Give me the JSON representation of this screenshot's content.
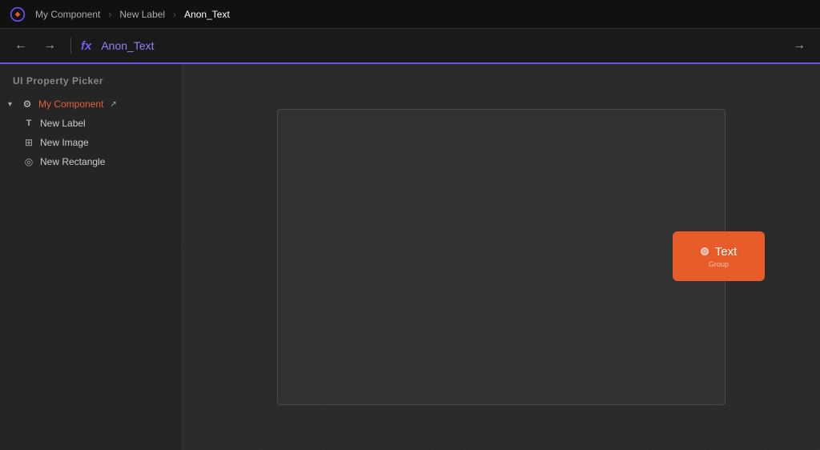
{
  "topbar": {
    "breadcrumbs": [
      {
        "label": "My Component",
        "active": false
      },
      {
        "label": "New Label",
        "active": false
      },
      {
        "label": "Anon_Text",
        "active": true
      }
    ]
  },
  "toolbar": {
    "back_label": "←",
    "forward_label": "→",
    "fx_label": "fx",
    "formula_value": "Anon_Text",
    "toolbar_back_label": "→"
  },
  "sidebar": {
    "title": "UI Property Picker",
    "tree": {
      "root": {
        "label": "My Component",
        "icon": "⚙",
        "children": [
          {
            "label": "New Label",
            "icon": "T"
          },
          {
            "label": "New Image",
            "icon": "⊞"
          },
          {
            "label": "New Rectangle",
            "icon": "◎"
          }
        ]
      }
    }
  },
  "canvas": {
    "element": {
      "text": "Text",
      "subtext": "Group",
      "dot_label": "dot"
    }
  }
}
